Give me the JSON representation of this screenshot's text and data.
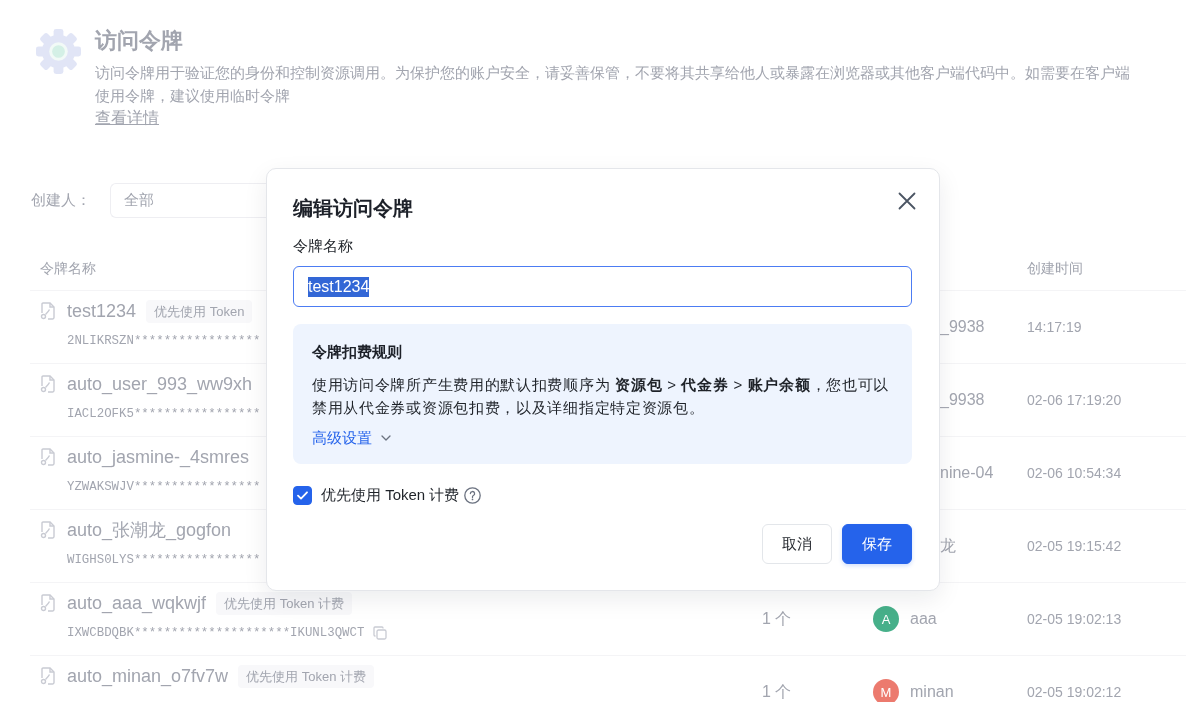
{
  "page_header": {
    "title": "访问令牌",
    "description_lines": [
      "访问令牌用于验证您的身份和控制资源调用。为保护您的账户安全，请妥善保管，不要将其共享给他人或暴露在浏览器或其他客户端代码中。如需要在客户端",
      "使用令牌，建议使用临时令牌"
    ],
    "link": "查看详情"
  },
  "filter": {
    "label": "创建人：",
    "value": "全部"
  },
  "table": {
    "columns": {
      "name": "令牌名称",
      "created_time": "创建时间"
    },
    "rows": [
      {
        "name": "test1234",
        "tag": "优先使用 Token",
        "key": "2NLIKRSZN*****************",
        "creator": {
          "name": "_9938"
        },
        "created_time": "14:17:19"
      },
      {
        "name": "auto_user_993_ww9xh",
        "key": "IACL2OFK5*****************",
        "creator": {
          "name": "_9938"
        },
        "created_time": "02-06 17:19:20"
      },
      {
        "name": "auto_jasmine-_4smres",
        "key": "YZWAKSWJV*****************",
        "creator": {
          "name": "nine-04"
        },
        "created_time": "02-06 10:54:34"
      },
      {
        "name": "auto_张潮龙_gogfon",
        "key": "WIGHS0LYS*****************",
        "creator": {
          "name": "龙"
        },
        "created_time": "02-05 19:15:42"
      },
      {
        "name": "auto_aaa_wqkwjf",
        "tag": "优先使用 Token 计费",
        "key": "IXWCBDQBK*********************IKUNL3QWCT",
        "copy_button": true,
        "count": "1 个",
        "creator": {
          "initial": "A",
          "name": "aaa",
          "color": "#47b08a"
        },
        "created_time": "02-05 19:02:13"
      },
      {
        "name": "auto_minan_o7fv7w",
        "tag": "优先使用 Token 计费",
        "count": "1 个",
        "creator": {
          "initial": "M",
          "name": "minan",
          "color": "#ec7a6e"
        },
        "created_time": "02-05 19:02:12"
      }
    ]
  },
  "dialog": {
    "title": "编辑访问令牌",
    "name_field": {
      "label": "令牌名称",
      "value": "test1234",
      "text_selected": true
    },
    "billing_rules": {
      "title": "令牌扣费规则",
      "text": "使用访问令牌所产生费用的默认扣费顺序为 **资源包** > **代金券** > **账户余额**，您也可以禁用从代金券或资源包扣费，以及详细指定特定资源包。",
      "advanced_link": {
        "label": "高级设置",
        "expanded": false
      }
    },
    "token_billing": {
      "label": "优先使用 Token 计费",
      "checked": true
    },
    "buttons": [
      {
        "label": "取消",
        "kind": "secondary"
      },
      {
        "label": "保存",
        "kind": "primary"
      }
    ]
  }
}
